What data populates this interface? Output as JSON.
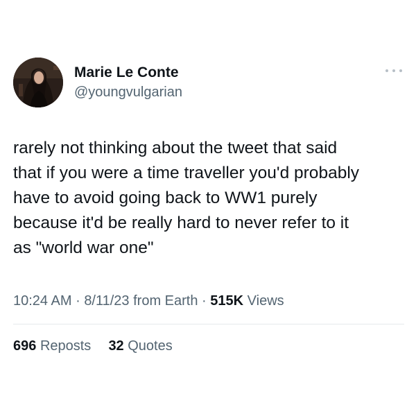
{
  "author": {
    "display_name": "Marie Le Conte",
    "handle": "@youngvulgarian",
    "avatar_icon": "profile-photo"
  },
  "more_icon": "ellipsis-icon",
  "tweet": {
    "lines": [
      "rarely not thinking about the tweet that said",
      "that if you were a time traveller you'd probably",
      "have to avoid going back to WW1 purely",
      "because it'd be really hard to never refer to it",
      "as \"world war one\""
    ]
  },
  "meta": {
    "time": "10:24 AM",
    "separator": "·",
    "date": "8/11/23",
    "source": "from Earth",
    "views_count": "515K",
    "views_label": "Views"
  },
  "stats": {
    "reposts_count": "696",
    "reposts_label": "Reposts",
    "quotes_count": "32",
    "quotes_label": "Quotes"
  },
  "colors": {
    "text": "#0f1419",
    "secondary": "#536471",
    "divider": "#e6e9eb"
  }
}
